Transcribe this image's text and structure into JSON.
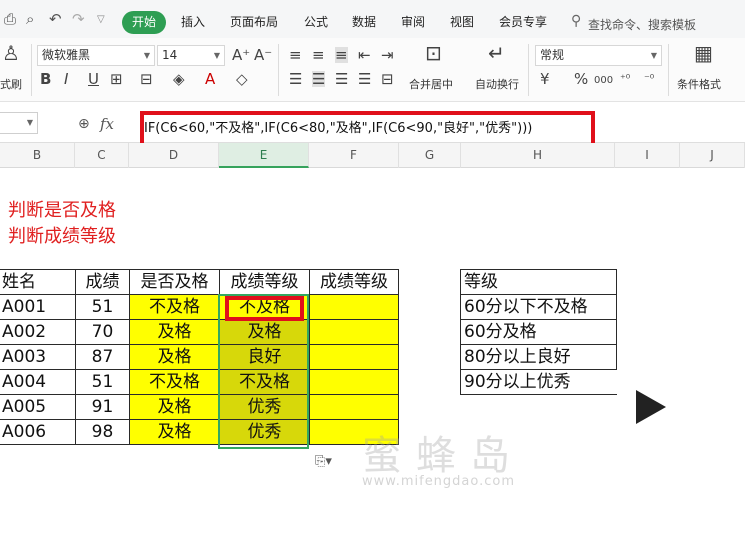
{
  "menu": {
    "tabs": [
      "开始",
      "插入",
      "页面布局",
      "公式",
      "数据",
      "审阅",
      "视图",
      "会员专享"
    ],
    "search_text": "查找命令、搜索模板"
  },
  "ribbon": {
    "format_painter": "式刷",
    "font_name": "微软雅黑",
    "font_size": "14",
    "merge_center": "合并居中",
    "wrap_text": "自动换行",
    "number_format": "常规",
    "conditional_format": "条件格式",
    "currency": "¥",
    "percent": "%",
    "thousands": "000"
  },
  "formula_bar": {
    "fx_label": "fx",
    "formula": "IF(C6<60,\"不及格\",IF(C6<80,\"及格\",IF(C6<90,\"良好\",\"优秀\")))"
  },
  "columns": [
    "B",
    "C",
    "D",
    "E",
    "F",
    "G",
    "H",
    "I",
    "J"
  ],
  "notes": [
    "判断是否及格",
    "判断成绩等级"
  ],
  "main_table": {
    "headers": [
      "姓名",
      "成绩",
      "是否及格",
      "成绩等级",
      "成绩等级"
    ],
    "rows": [
      [
        "A001",
        "51",
        "不及格",
        "不及格",
        ""
      ],
      [
        "A002",
        "70",
        "及格",
        "及格",
        ""
      ],
      [
        "A003",
        "87",
        "及格",
        "良好",
        ""
      ],
      [
        "A004",
        "51",
        "不及格",
        "不及格",
        ""
      ],
      [
        "A005",
        "91",
        "及格",
        "优秀",
        ""
      ],
      [
        "A006",
        "98",
        "及格",
        "优秀",
        ""
      ]
    ]
  },
  "grade_table": {
    "header": "等级",
    "rows": [
      "60分以下不及格",
      "60分及格",
      "80分以上良好",
      "90分以上优秀"
    ]
  },
  "watermark": {
    "chars": "蜜蜂岛",
    "url": "www.mifengdao.com"
  },
  "colors": {
    "accent_green": "#2e9e53",
    "highlight_red": "#e0101a",
    "cell_yellow": "#ffff00",
    "selected_olive": "#d7d80a"
  }
}
